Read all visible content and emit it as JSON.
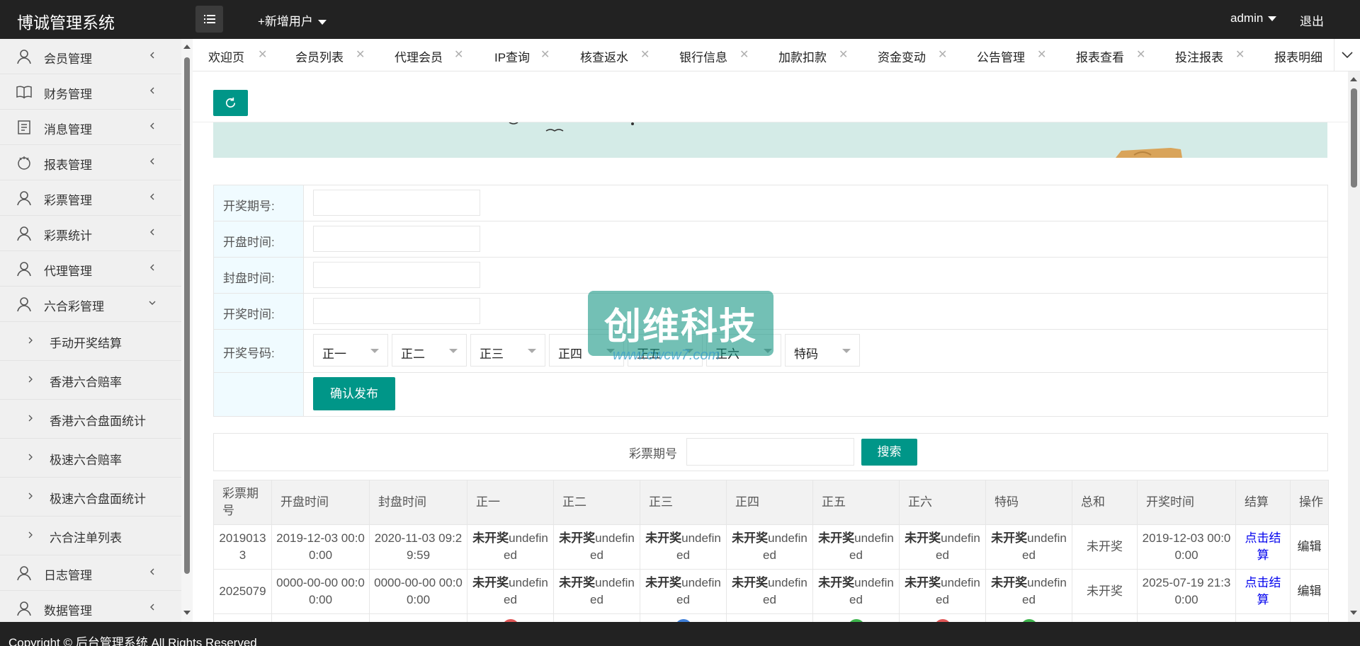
{
  "header": {
    "brand": "博诚管理系统",
    "add_user": "+新增用户",
    "admin": "admin",
    "logout": "退出"
  },
  "sidebar": {
    "items": [
      {
        "label": "会员管理",
        "icon": "user-icon"
      },
      {
        "label": "财务管理",
        "icon": "book-icon"
      },
      {
        "label": "消息管理",
        "icon": "message-icon"
      },
      {
        "label": "报表管理",
        "icon": "report-icon"
      },
      {
        "label": "彩票管理",
        "icon": "user-icon"
      },
      {
        "label": "彩票统计",
        "icon": "user-icon"
      },
      {
        "label": "代理管理",
        "icon": "user-icon"
      },
      {
        "label": "六合彩管理",
        "icon": "user-icon"
      }
    ],
    "subitems": [
      {
        "label": "手动开奖结算"
      },
      {
        "label": "香港六合赔率"
      },
      {
        "label": "香港六合盘面统计"
      },
      {
        "label": "极速六合赔率"
      },
      {
        "label": "极速六合盘面统计"
      },
      {
        "label": "六合注单列表"
      }
    ],
    "bottom_items": [
      {
        "label": "日志管理",
        "icon": "user-icon"
      },
      {
        "label": "数据管理",
        "icon": "user-icon"
      }
    ]
  },
  "tabs": [
    {
      "label": "欢迎页"
    },
    {
      "label": "会员列表"
    },
    {
      "label": "代理会员"
    },
    {
      "label": "IP查询"
    },
    {
      "label": "核查返水"
    },
    {
      "label": "银行信息"
    },
    {
      "label": "加款扣款"
    },
    {
      "label": "资金变动"
    },
    {
      "label": "公告管理"
    },
    {
      "label": "报表查看"
    },
    {
      "label": "投注报表"
    },
    {
      "label": "报表明细"
    }
  ],
  "form": {
    "issue_label": "开奖期号:",
    "open_label": "开盘时间:",
    "close_label": "封盘时间:",
    "draw_label": "开奖时间:",
    "numbers_label": "开奖号码:",
    "selects": [
      "正一",
      "正二",
      "正三",
      "正四",
      "正五",
      "正六",
      "特码"
    ],
    "publish": "确认发布"
  },
  "search": {
    "label": "彩票期号",
    "button": "搜索"
  },
  "table": {
    "headers": [
      "彩票期号",
      "开盘时间",
      "封盘时间",
      "正一",
      "正二",
      "正三",
      "正四",
      "正五",
      "正六",
      "特码",
      "总和",
      "开奖时间",
      "结算",
      "操作"
    ],
    "not_drawn": "未开奖",
    "undefined": "undefined",
    "rows": [
      {
        "issue": "20190133",
        "open": "2019-12-03 00:00:00",
        "close": "2020-11-03 09:29:59",
        "sum": "未开奖",
        "draw": "2019-12-03 00:00:00",
        "settle": "点击结算",
        "edit": "编辑"
      },
      {
        "issue": "2025079",
        "open": "0000-00-00 00:00:00",
        "close": "0000-00-00 00:00:00",
        "sum": "未开奖",
        "draw": "2025-07-19 21:30:00",
        "settle": "点击结算",
        "edit": "编辑"
      }
    ]
  },
  "watermark": {
    "text": "创维科技",
    "url": "www.cwcw7.com"
  },
  "footer": "Copyright © 后台管理系统 All Rights Reserved",
  "colors": {
    "header_bg": "#222222",
    "accent": "#009688",
    "sidebar_bg": "#f0f0f0"
  }
}
